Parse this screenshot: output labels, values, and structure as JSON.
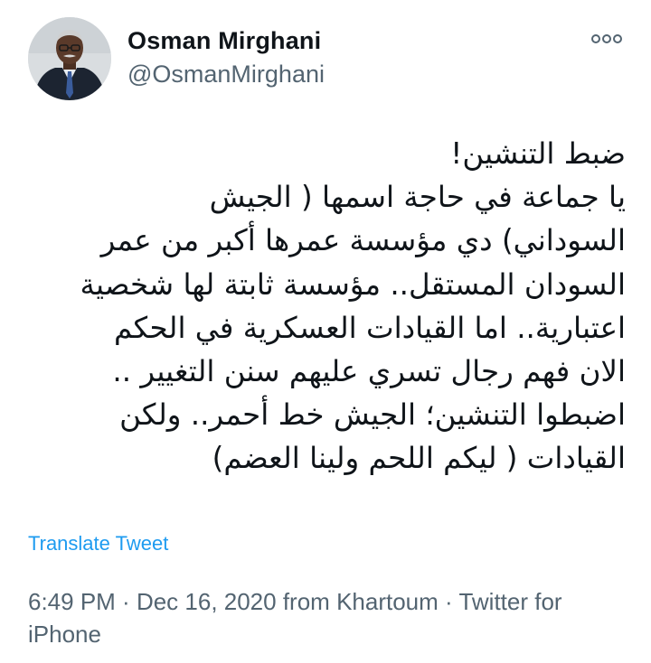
{
  "author": {
    "display_name": "Osman Mirghani",
    "handle": "@OsmanMirghani",
    "avatar_icon": "profile-photo"
  },
  "more_icon": "more-options-icon",
  "tweet": {
    "lines": [
      "ضبط التنشين!",
      "يا جماعة في حاجة اسمها ( الجيش",
      "السوداني) دي مؤسسة عمرها أكبر من عمر",
      "السودان المستقل.. مؤسسة ثابتة لها شخصية",
      "اعتبارية.. اما القيادات العسكرية في الحكم",
      "الان فهم رجال تسري عليهم   سنن التغيير ..",
      "اضبطوا التنشين؛  الجيش خط أحمر.. ولكن",
      "القيادات ( ليكم اللحم ولينا العضم)"
    ]
  },
  "translate_label": "Translate Tweet",
  "meta": {
    "time": "6:49 PM",
    "separator": " · ",
    "date": "Dec 16, 2020",
    "from_prefix": " from ",
    "location": "Khartoum",
    "separator2": " · ",
    "source": "Twitter for iPhone"
  },
  "colors": {
    "text": "#0f1419",
    "secondary": "#536471",
    "link": "#1d9bf0",
    "background": "#ffffff"
  }
}
